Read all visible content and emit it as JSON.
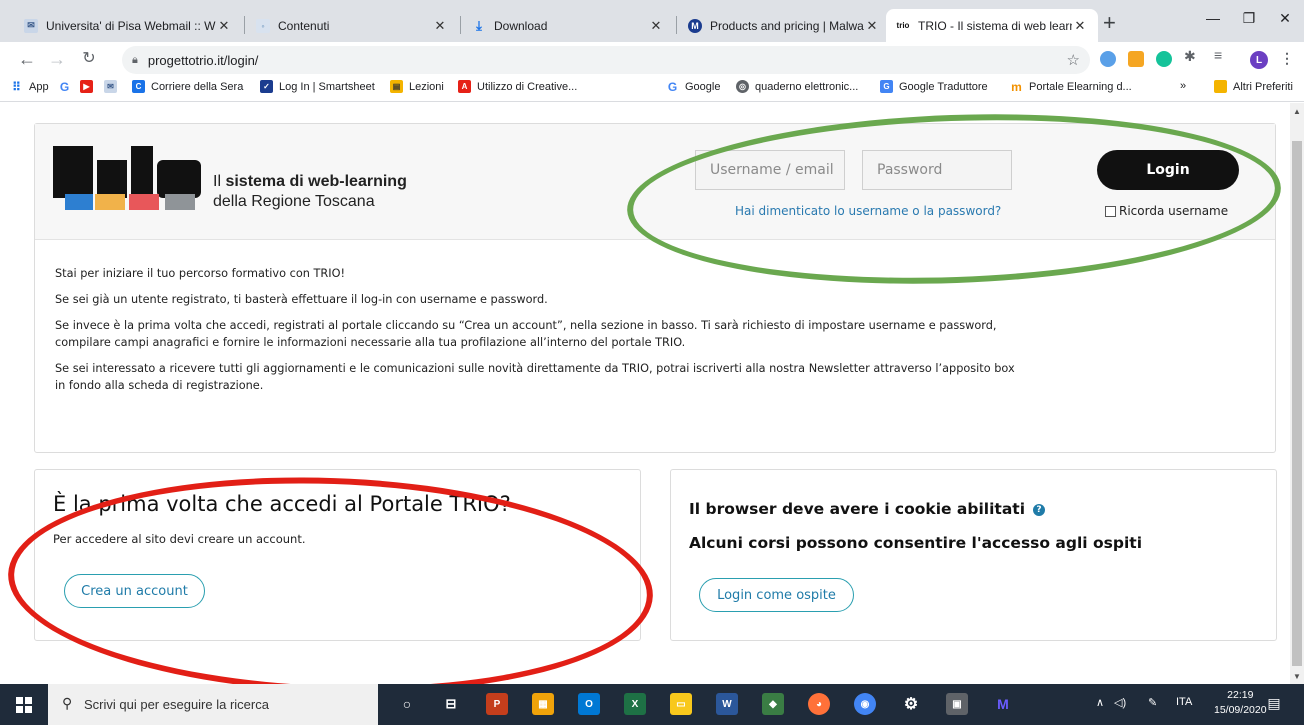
{
  "browser": {
    "tabs": [
      {
        "title": "Universita' di Pisa Webmail :: W",
        "active": false
      },
      {
        "title": "Contenuti",
        "active": false
      },
      {
        "title": "Download",
        "active": false
      },
      {
        "title": "Products and pricing | Malware",
        "active": false
      },
      {
        "title": "TRIO - Il sistema di web learnin",
        "active": true
      }
    ],
    "address": "progettotrio.it/login/",
    "bookmarks": [
      "App",
      "Corriere della Sera",
      "Log In | Smartsheet",
      "Lezioni",
      "Utilizzo di Creative...",
      "Google",
      "quaderno elettronic...",
      "Google Traduttore",
      "Portale Elearning d...",
      "Altri Preferiti"
    ],
    "more_bookmarks": "»",
    "profile_initial": "L"
  },
  "header": {
    "logo_text": "trio",
    "tagline_prefix": "Il ",
    "tagline_bold": "sistema di web-learning",
    "tagline_line2": "della Regione Toscana",
    "username_placeholder": "Username / email",
    "password_placeholder": "Password",
    "login_label": "Login",
    "forgot_link": "Hai dimenticato lo username o la password?",
    "remember_label": "Ricorda username"
  },
  "intro": [
    "Stai per iniziare il tuo percorso formativo con TRIO!",
    "Se sei già un utente registrato, ti basterà effettuare il log-in con username e password.",
    "Se invece è la prima volta che accedi, registrati al portale cliccando su “Crea un account”, nella sezione in basso. Ti sarà richiesto di impostare username e password, compilare campi anagrafici e fornire le informazioni necessarie alla tua profilazione all’interno del portale TRIO.",
    "Se sei interessato a ricevere tutti gli aggiornamenti e le comunicazioni sulle novità direttamente da TRIO, potrai iscriverti alla nostra Newsletter attraverso l’apposito box in fondo alla scheda di registrazione."
  ],
  "signup": {
    "heading": "È la prima volta che accedi al Portale TRIO?",
    "text": "Per accedere al sito devi creare un account.",
    "button": "Crea un account"
  },
  "guest": {
    "cookie_heading": "Il browser deve avere i cookie abilitati",
    "guest_heading": "Alcuni corsi possono consentire l'accesso agli ospiti",
    "button": "Login come ospite"
  },
  "taskbar": {
    "search_placeholder": "Scrivi qui per eseguire la ricerca",
    "lang": "ITA",
    "time": "22:19",
    "date": "15/09/2020"
  },
  "colors": {
    "annotation_green": "#6aa84f",
    "annotation_red": "#e21f16",
    "link_blue": "#2a7ab0"
  }
}
